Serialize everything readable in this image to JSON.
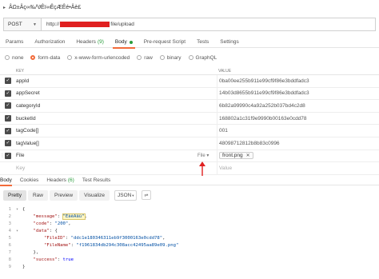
{
  "title": "ÂΩ±Âç∞‰ª∂Êï∞ÊçÆÊé•Âè£",
  "request": {
    "method": "POST",
    "url_prefix": "http://",
    "url_suffix": "file/upload"
  },
  "request_tabs": [
    {
      "label": "Params"
    },
    {
      "label": "Authorization"
    },
    {
      "label": "Headers",
      "count": "(9)"
    },
    {
      "label": "Body"
    },
    {
      "label": "Pre-request Script"
    },
    {
      "label": "Tests"
    },
    {
      "label": "Settings"
    }
  ],
  "body_types": [
    {
      "label": "none"
    },
    {
      "label": "form-data"
    },
    {
      "label": "x-www-form-urlencoded"
    },
    {
      "label": "raw"
    },
    {
      "label": "binary"
    },
    {
      "label": "GraphQL"
    }
  ],
  "table": {
    "key_header": "KEY",
    "value_header": "VALUE",
    "rows": [
      {
        "key": "appId",
        "value": "0ba00ee255b911e99cf9f86e3bddfadc3"
      },
      {
        "key": "appSecret",
        "value": "14b03d8655b911e99cf9f86e3bddfadc3"
      },
      {
        "key": "categoryId",
        "value": "6b82a99990c4a92a252b037bd4c2d8"
      },
      {
        "key": "bucketId",
        "value": "168802a1c31f9e9990b00163e0cdd78"
      },
      {
        "key": "tagCode[]",
        "value": "001"
      },
      {
        "key": "tagValue[]",
        "value": "48098712812b8b83c0996"
      }
    ],
    "file_row": {
      "key": "File",
      "type": "File",
      "value": "front.png",
      "remove": "✕"
    },
    "placeholder_key": "Key",
    "placeholder_value": "Value"
  },
  "response_tabs": [
    {
      "label": "Body"
    },
    {
      "label": "Cookies"
    },
    {
      "label": "Headers",
      "count": "(6)"
    },
    {
      "label": "Test Results"
    }
  ],
  "response_toolbar": {
    "pretty": "Pretty",
    "raw": "Raw",
    "preview": "Preview",
    "visualize": "Visualize",
    "language": "JSON",
    "wrap_icon": "wrap-lines-icon"
  },
  "response_body": {
    "line_numbers": [
      "1",
      "2",
      "3",
      "4",
      "5",
      "6",
      "7",
      "8",
      "9"
    ],
    "message_key": "\"message\"",
    "message_value": "\"ÊàêÂäü\"",
    "code_key": "\"code\"",
    "code_value": "\"200\"",
    "data_key": "\"data\"",
    "file_id_key": "\"FileID\"",
    "file_id_value": "\"ddc1e180346311eb9f3000163e0cdd78\"",
    "file_name_key": "\"FileName\"",
    "file_name_value": "\"f1961834db294c308acc42495aa89e09.png\"",
    "success_key": "\"success\"",
    "success_value": "true"
  },
  "colors": {
    "accent": "#f26b3a",
    "count_green": "#2a9d3c",
    "redaction": "#e02020"
  }
}
